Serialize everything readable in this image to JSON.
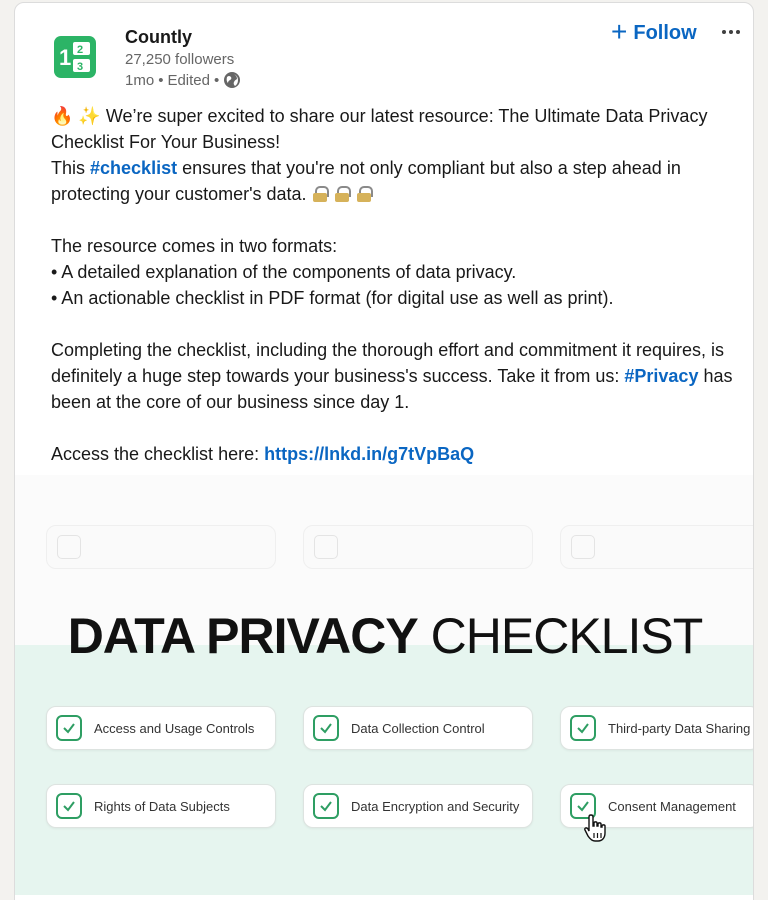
{
  "header": {
    "org_name": "Countly",
    "followers": "27,250 followers",
    "time": "1mo",
    "edited": "Edited",
    "follow_label": "Follow",
    "logo_icon": "countly-logo-icon",
    "globe_icon": "globe-icon",
    "more_icon": "more-options-icon"
  },
  "post": {
    "intro_emoji": "🔥 ✨",
    "intro_text": "We’re super excited to share our latest resource: The Ultimate Data Privacy Checklist For Your Business!",
    "line2_pre": "This ",
    "line2_tag": "#checklist",
    "line2_post": " ensures that you're not only compliant but also a step ahead in protecting your customer's data.",
    "formats_intro": "The resource comes in two formats:",
    "format_1": "• A detailed explanation of the components of data privacy.",
    "format_2": "• An actionable checklist in PDF format (for digital use as well as print).",
    "para3_pre": "Completing the checklist, including the thorough effort and commitment it requires, is definitely a huge step towards your business's success. Take it from us: ",
    "para3_tag": "#Privacy",
    "para3_post": " has been at the core of our business since day 1.",
    "access_pre": "Access the checklist here: ",
    "access_link": "https://lnkd.in/g7tVpBaQ"
  },
  "image": {
    "title_bold": "DATA PRIVACY",
    "title_light": "CHECKLIST",
    "items": [
      "Access and Usage Controls",
      "Data Collection Control",
      "Third-party Data Sharing",
      "Rights of Data Subjects",
      "Data Encryption and Security",
      "Consent Management"
    ],
    "accent_color": "#2e9e63",
    "background_color": "#e6f5ef"
  },
  "colors": {
    "link": "#0a66c2",
    "text": "#191919",
    "muted": "#666666"
  }
}
